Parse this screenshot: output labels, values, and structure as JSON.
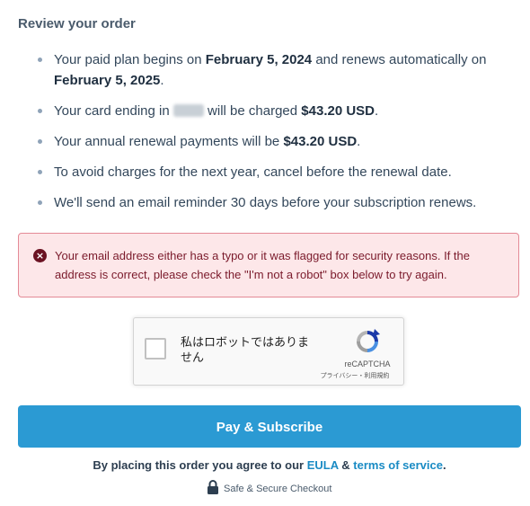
{
  "review": {
    "title": "Review your order",
    "items": [
      {
        "prefix": "Your paid plan begins on ",
        "start_date": "February 5, 2024",
        "middle": " and renews automatically on ",
        "renew_date": "February 5, 2025",
        "suffix": "."
      },
      {
        "prefix": "Your card ending in ",
        "middle": " will be charged ",
        "amount": "$43.20 USD",
        "suffix": "."
      },
      {
        "prefix": "Your annual renewal payments will be ",
        "amount": "$43.20 USD",
        "suffix": "."
      },
      {
        "text": "To avoid charges for the next year, cancel before the renewal date."
      },
      {
        "text": "We'll send an email reminder 30 days before your subscription renews."
      }
    ]
  },
  "alert": {
    "icon": "error-x-icon",
    "text": "Your email address either has a typo or it was flagged for security reasons. If the address is correct, please check the \"I'm not a robot\" box below to try again."
  },
  "captcha": {
    "label": "私はロボットではありません",
    "brand": "reCAPTCHA",
    "links": "プライバシー・利用規約",
    "checked": false
  },
  "pay_button": {
    "label": "Pay & Subscribe"
  },
  "agreement": {
    "prefix": "By placing this order you agree to our ",
    "eula_link": "EULA",
    "joiner": " & ",
    "tos_link": "terms of service",
    "suffix": "."
  },
  "secure": {
    "icon": "lock-icon",
    "text": "Safe & Secure Checkout"
  },
  "colors": {
    "accent": "#2b9ad3",
    "link": "#1a8bc4",
    "alert_bg": "#fde7e9",
    "alert_border": "#e48a96",
    "alert_text": "#7a1a2b"
  }
}
